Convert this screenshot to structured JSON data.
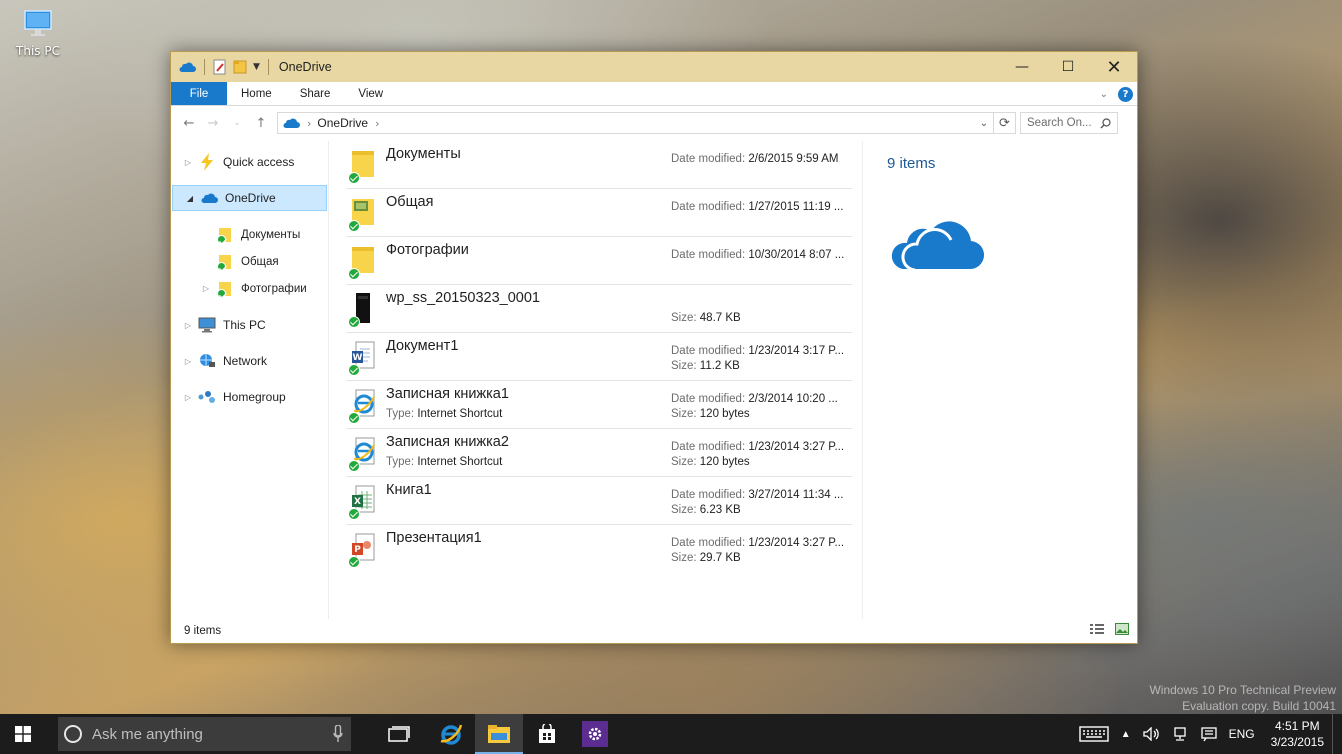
{
  "desktop": {
    "this_pc_label": "This PC"
  },
  "window": {
    "title": "OneDrive",
    "tabs": {
      "file": "File",
      "home": "Home",
      "share": "Share",
      "view": "View"
    },
    "address": {
      "crumb": "OneDrive"
    },
    "search": {
      "placeholder": "Search On..."
    }
  },
  "nav": {
    "quick_access": "Quick access",
    "onedrive": "OneDrive",
    "documents": "Документы",
    "shared": "Общая",
    "photos": "Фотографии",
    "this_pc": "This PC",
    "network": "Network",
    "homegroup": "Homegroup"
  },
  "files": [
    {
      "name": "Документы",
      "date_label": "Date modified:",
      "date": "2/6/2015 9:59 AM"
    },
    {
      "name": "Общая",
      "date_label": "Date modified:",
      "date": "1/27/2015 11:19 ..."
    },
    {
      "name": "Фотографии",
      "date_label": "Date modified:",
      "date": "10/30/2014 8:07 ..."
    },
    {
      "name": "wp_ss_20150323_0001",
      "size_label": "Size:",
      "size": "48.7 KB"
    },
    {
      "name": "Документ1",
      "date_label": "Date modified:",
      "date": "1/23/2014 3:17 P...",
      "size_label": "Size:",
      "size": "11.2 KB"
    },
    {
      "name": "Записная книжка1",
      "type_label": "Type:",
      "type": "Internet Shortcut",
      "date_label": "Date modified:",
      "date": "2/3/2014 10:20 ...",
      "size_label": "Size:",
      "size": "120 bytes"
    },
    {
      "name": "Записная книжка2",
      "type_label": "Type:",
      "type": "Internet Shortcut",
      "date_label": "Date modified:",
      "date": "1/23/2014 3:27 P...",
      "size_label": "Size:",
      "size": "120 bytes"
    },
    {
      "name": "Книга1",
      "date_label": "Date modified:",
      "date": "3/27/2014 11:34 ...",
      "size_label": "Size:",
      "size": "6.23 KB"
    },
    {
      "name": "Презентация1",
      "date_label": "Date modified:",
      "date": "1/23/2014 3:27 P...",
      "size_label": "Size:",
      "size": "29.7 KB"
    }
  ],
  "details": {
    "count": "9 items"
  },
  "status": {
    "count": "9 items"
  },
  "watermark": {
    "line1": "Windows 10 Pro Technical Preview",
    "line2": "Evaluation copy. Build 10041"
  },
  "taskbar": {
    "search_placeholder": "Ask me anything",
    "lang": "ENG",
    "time": "4:51 PM",
    "date": "3/23/2015"
  },
  "colors": {
    "accent": "#1979ca",
    "titlebar": "#e8d7a2",
    "selection": "#cce8ff",
    "sync_ok": "#22a93a"
  }
}
